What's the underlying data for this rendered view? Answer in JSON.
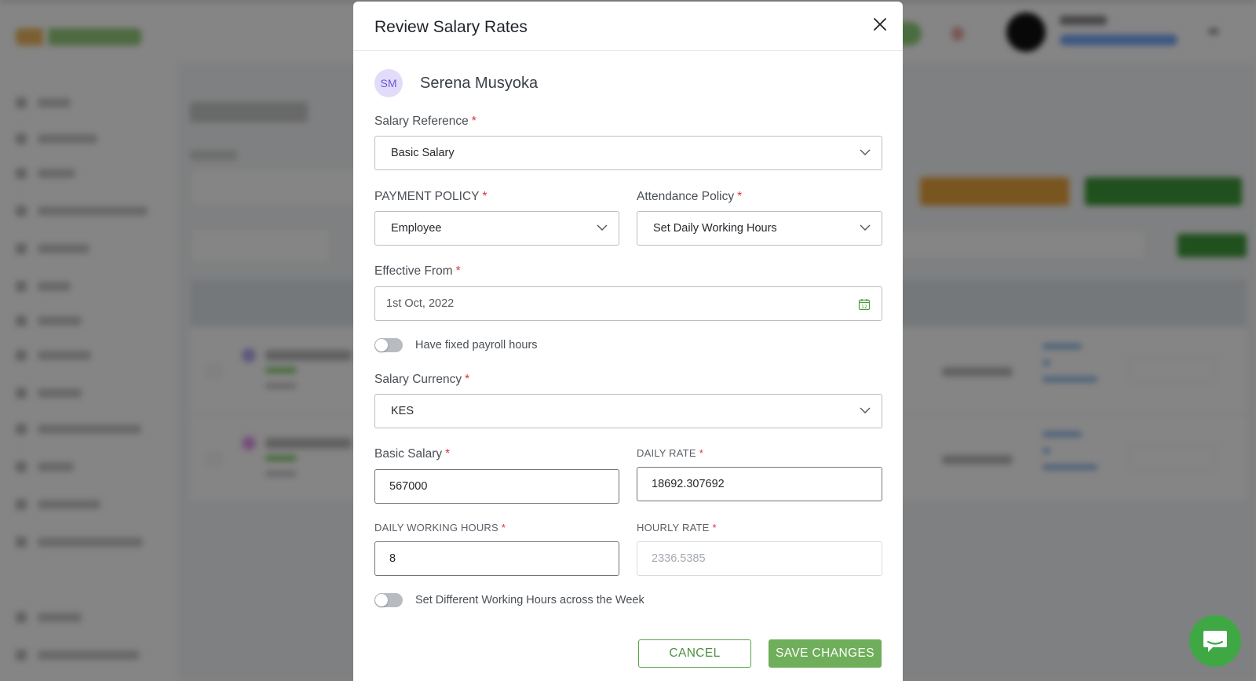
{
  "modal": {
    "title": "Review Salary Rates",
    "employee": {
      "initials": "SM",
      "name": "Serena Musyoka"
    },
    "salary_reference": {
      "label": "Salary Reference",
      "value": "Basic Salary"
    },
    "payment_policy": {
      "label": "PAYMENT POLICY",
      "value": "Employee"
    },
    "attendance_policy": {
      "label": "Attendance Policy",
      "value": "Set Daily Working Hours"
    },
    "effective_from": {
      "label": "Effective From",
      "value": "1st Oct, 2022"
    },
    "fixed_payroll_hours": {
      "label": "Have fixed payroll hours",
      "enabled": false
    },
    "salary_currency": {
      "label": "Salary Currency",
      "value": "KES"
    },
    "basic_salary": {
      "label": "Basic Salary",
      "value": "567000"
    },
    "daily_rate": {
      "label": "DAILY RATE",
      "value": "18692.307692"
    },
    "daily_working_hours": {
      "label": "DAILY WORKING HOURS",
      "value": "8"
    },
    "hourly_rate": {
      "label": "HOURLY RATE",
      "placeholder": "2336.5385"
    },
    "different_hours": {
      "label": "Set Different Working Hours across the Week",
      "enabled": false
    },
    "required_mark": "*",
    "cancel_label": "CANCEL",
    "save_label": "SAVE CHANGES"
  },
  "colors": {
    "accent_green": "#6fae5a",
    "required_red": "#d9333f",
    "avatar_bg": "#e2dcfa",
    "chat_green": "#3fa845"
  },
  "icons": {
    "close": "close-icon",
    "chevron": "chevron-down-icon",
    "calendar": "calendar-icon",
    "chat": "chat-icon"
  }
}
